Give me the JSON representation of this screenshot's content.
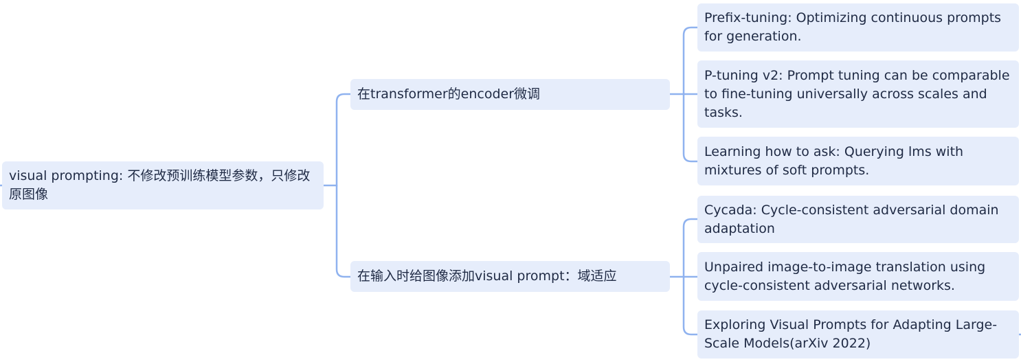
{
  "colors": {
    "node_fill": "#e6edfb",
    "connector": "#8fb2ef",
    "text": "#1f2a44"
  },
  "root": {
    "label": "visual prompting: 不修改预训练模型参数，只修改原图像"
  },
  "branches": [
    {
      "label": "在transformer的encoder微调",
      "children": [
        "Prefix-tuning: Optimizing continuous prompts for generation.",
        "P-tuning v2: Prompt tuning can be comparable to fine-tuning universally across scales and tasks.",
        "Learning how to ask: Querying lms with mixtures of soft prompts."
      ]
    },
    {
      "label": "在输入时给图像添加visual prompt：域适应",
      "children": [
        "Cycada: Cycle-consistent adversarial domain adaptation",
        "Unpaired image-to-image translation using cycle-consistent adversarial networks.",
        "Exploring Visual Prompts for Adapting Large-Scale Models(arXiv 2022)"
      ]
    }
  ]
}
